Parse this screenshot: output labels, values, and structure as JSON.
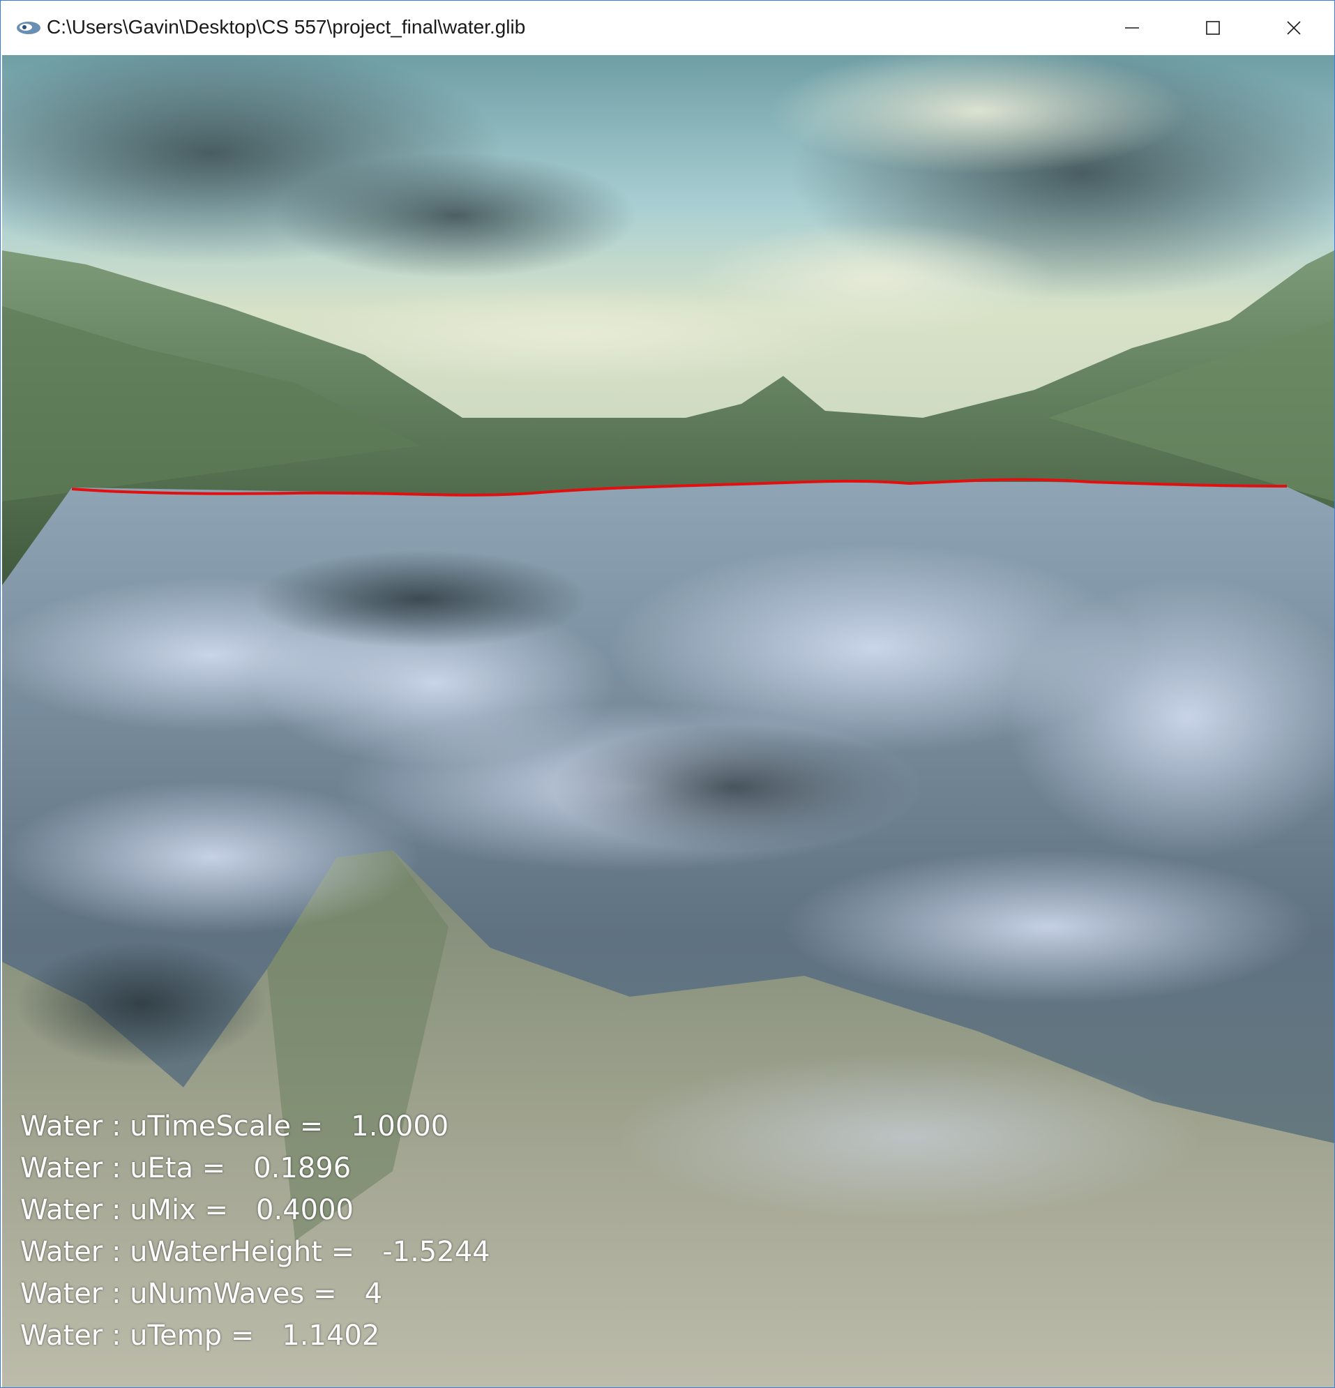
{
  "window": {
    "title": "C:\\Users\\Gavin\\Desktop\\CS 557\\project_final\\water.glib",
    "icon": "glman-app-icon",
    "controls": {
      "minimize_icon": "minimize-icon",
      "maximize_icon": "maximize-icon",
      "close_icon": "close-icon"
    }
  },
  "scene": {
    "annotation_color": "#e01010",
    "sky_color": "#a9cfd3",
    "mountain_color": "#5f7f55",
    "water_fog_color": "#b8c8dc"
  },
  "readout": [
    {
      "label": "Water : uTimeScale =",
      "value": "1.0000"
    },
    {
      "label": "Water : uEta =",
      "value": "0.1896"
    },
    {
      "label": "Water : uMix =",
      "value": "0.4000"
    },
    {
      "label": "Water : uWaterHeight =",
      "value": "-1.5244"
    },
    {
      "label": "Water : uNumWaves =",
      "value": "4"
    },
    {
      "label": "Water : uTemp =",
      "value": "1.1402"
    }
  ]
}
